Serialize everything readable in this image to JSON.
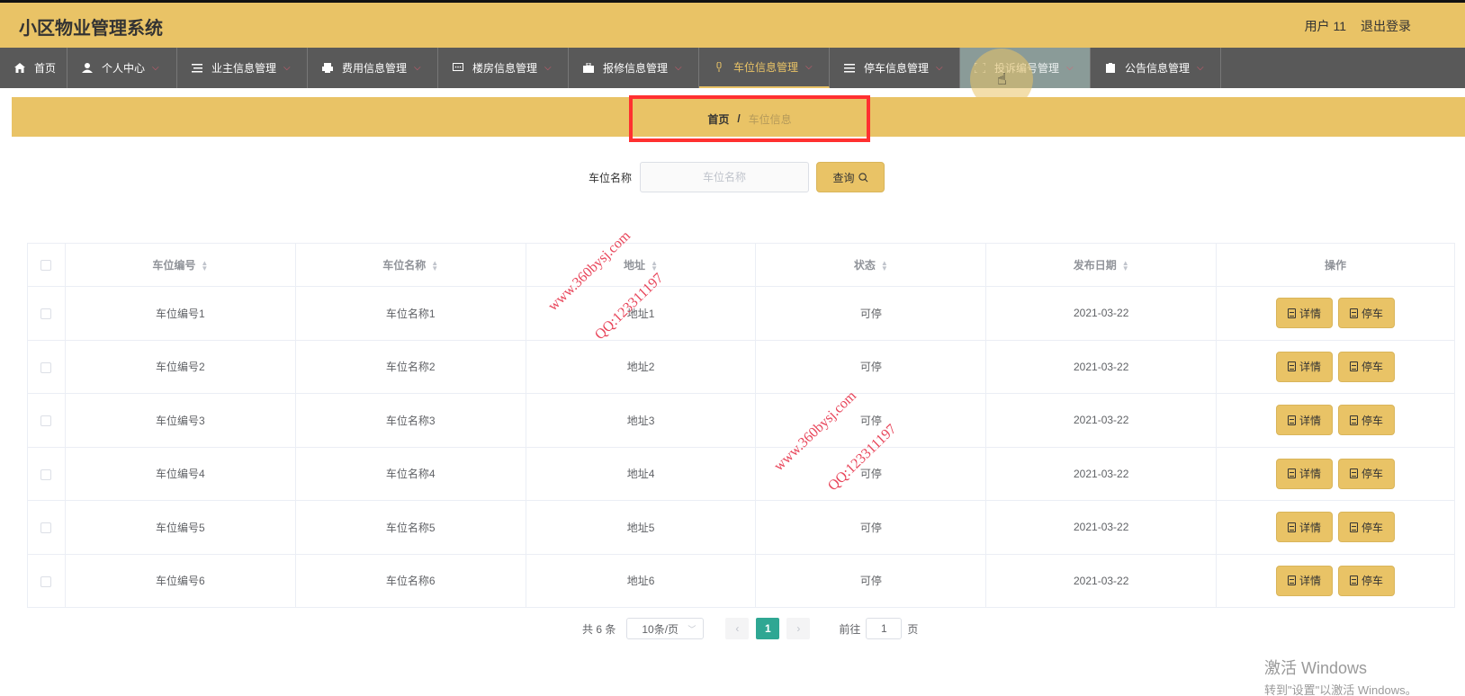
{
  "header": {
    "title": "小区物业管理系统",
    "user": "用户 11",
    "logout": "退出登录"
  },
  "nav": [
    {
      "label": "首页",
      "icon": "home-icon",
      "caret": false
    },
    {
      "label": "个人中心",
      "icon": "user-icon",
      "caret": true
    },
    {
      "label": "业主信息管理",
      "icon": "list-icon",
      "caret": true
    },
    {
      "label": "费用信息管理",
      "icon": "printer-icon",
      "caret": true
    },
    {
      "label": "楼房信息管理",
      "icon": "message-icon",
      "caret": true
    },
    {
      "label": "报修信息管理",
      "icon": "briefcase-icon",
      "caret": true
    },
    {
      "label": "车位信息管理",
      "icon": "microphone-icon",
      "caret": true,
      "active": true
    },
    {
      "label": "停车信息管理",
      "icon": "menu-icon",
      "caret": true
    },
    {
      "label": "投诉编号管理",
      "icon": "frame-icon",
      "caret": true,
      "hovered": true
    },
    {
      "label": "公告信息管理",
      "icon": "clipboard-icon",
      "caret": true
    }
  ],
  "breadcrumb": {
    "home": "首页",
    "separator": "/",
    "current": "车位信息"
  },
  "search": {
    "label": "车位名称",
    "placeholder": "车位名称",
    "button": "查询"
  },
  "table": {
    "headers": [
      "车位编号",
      "车位名称",
      "地址",
      "状态",
      "发布日期",
      "操作"
    ],
    "rows": [
      {
        "code": "车位编号1",
        "name": "车位名称1",
        "address": "地址1",
        "status": "可停",
        "date": "2021-03-22"
      },
      {
        "code": "车位编号2",
        "name": "车位名称2",
        "address": "地址2",
        "status": "可停",
        "date": "2021-03-22"
      },
      {
        "code": "车位编号3",
        "name": "车位名称3",
        "address": "地址3",
        "status": "可停",
        "date": "2021-03-22"
      },
      {
        "code": "车位编号4",
        "name": "车位名称4",
        "address": "地址4",
        "status": "可停",
        "date": "2021-03-22"
      },
      {
        "code": "车位编号5",
        "name": "车位名称5",
        "address": "地址5",
        "status": "可停",
        "date": "2021-03-22"
      },
      {
        "code": "车位编号6",
        "name": "车位名称6",
        "address": "地址6",
        "status": "可停",
        "date": "2021-03-22"
      }
    ],
    "detail_btn": "详情",
    "park_btn": "停车"
  },
  "pagination": {
    "total": "共 6 条",
    "page_size": "10条/页",
    "current_page": "1",
    "goto_label": "前往",
    "goto_value": "1",
    "page_suffix": "页"
  },
  "watermarks": [
    {
      "site": "www.360bysj.com",
      "qq": "QQ:123311197"
    },
    {
      "site": "www.360bysj.com",
      "qq": "QQ:123311197"
    }
  ],
  "windows": {
    "title": "激活 Windows",
    "subtitle": "转到\"设置\"以激活 Windows。"
  },
  "colors": {
    "accent": "#e9c366",
    "nav_bg": "#595959",
    "page_active": "#2fa793",
    "highlight_box": "#ff3030",
    "watermark": "#e8455a"
  }
}
